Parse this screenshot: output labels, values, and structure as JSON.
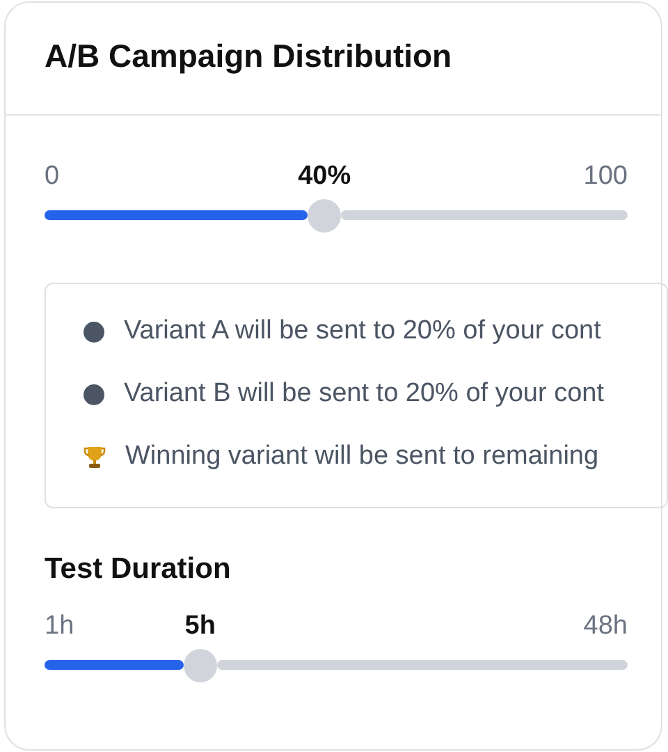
{
  "card": {
    "title": "A/B Campaign Distribution"
  },
  "distribution_slider": {
    "min_label": "0",
    "value_label": "40%",
    "max_label": "100",
    "level": 0.48
  },
  "info_box": {
    "items": [
      {
        "kind": "dot",
        "text": "Variant A will be sent to 20% of your cont"
      },
      {
        "kind": "dot",
        "text": "Variant B will be sent to 20% of your cont"
      },
      {
        "kind": "trophy",
        "text": "Winning variant will be sent to remaining"
      }
    ]
  },
  "duration": {
    "title": "Test Duration",
    "min_label": "1h",
    "value_label": "5h",
    "max_label": "48h",
    "level": 0.267
  }
}
